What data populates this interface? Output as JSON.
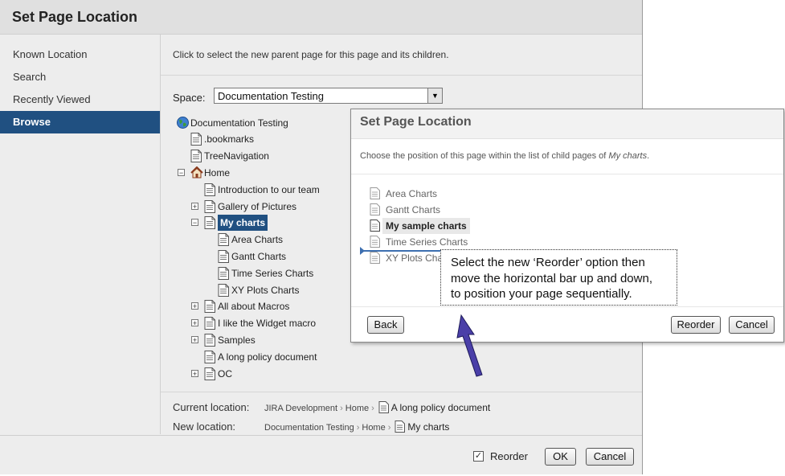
{
  "dialog": {
    "title": "Set Page Location",
    "nav": [
      {
        "label": "Known Location",
        "active": false
      },
      {
        "label": "Search",
        "active": false
      },
      {
        "label": "Recently Viewed",
        "active": false
      },
      {
        "label": "Browse",
        "active": true
      }
    ],
    "instruction": "Click to select the new parent page for this page and its children.",
    "space_label": "Space:",
    "space_value": "Documentation Testing",
    "tree": [
      {
        "label": "Documentation Testing",
        "icon": "globe-icon",
        "expander": ""
      },
      {
        "label": ".bookmarks",
        "icon": "page-icon",
        "expander": ""
      },
      {
        "label": "TreeNavigation",
        "icon": "page-icon",
        "expander": ""
      },
      {
        "label": "Home",
        "icon": "home-icon",
        "expander": "⊟"
      },
      {
        "label": "Introduction to our team",
        "icon": "page-icon",
        "expander": ""
      },
      {
        "label": "Gallery of Pictures",
        "icon": "page-icon",
        "expander": "⊞"
      },
      {
        "label": "My charts",
        "icon": "page-icon",
        "expander": "⊟",
        "selected": true
      },
      {
        "label": "Area Charts",
        "icon": "page-icon",
        "expander": ""
      },
      {
        "label": "Gantt Charts",
        "icon": "page-icon",
        "expander": ""
      },
      {
        "label": "Time Series Charts",
        "icon": "page-icon",
        "expander": ""
      },
      {
        "label": "XY Plots Charts",
        "icon": "page-icon",
        "expander": ""
      },
      {
        "label": "All about Macros",
        "icon": "page-icon",
        "expander": "⊞"
      },
      {
        "label": "I like the Widget macro",
        "icon": "page-icon",
        "expander": "⊞"
      },
      {
        "label": "Samples",
        "icon": "page-icon",
        "expander": "⊞"
      },
      {
        "label": "A long policy document",
        "icon": "page-icon",
        "expander": ""
      },
      {
        "label": "OC",
        "icon": "page-icon",
        "expander": "⊞"
      }
    ],
    "current_location": {
      "label": "Current location:",
      "space": "JIRA Development",
      "parent": "Home",
      "page": "A long policy document"
    },
    "new_location": {
      "label": "New location:",
      "space": "Documentation Testing",
      "parent": "Home",
      "page": "My charts"
    },
    "path_separator": "›",
    "reorder_label": "Reorder",
    "reorder_checked": true,
    "ok_label": "OK",
    "cancel_label": "Cancel"
  },
  "order_dialog": {
    "title": "Set Page Location",
    "instruction_prefix": "Choose the position of this page within the list of child pages of ",
    "instruction_parent": "My charts",
    "instruction_suffix": ".",
    "pages": [
      {
        "label": "Area Charts",
        "current": false
      },
      {
        "label": "Gantt Charts",
        "current": false
      },
      {
        "label": "My sample charts",
        "current": true
      },
      {
        "label": "Time Series Charts",
        "current": false
      },
      {
        "label": "XY Plots Charts",
        "current": false
      }
    ],
    "back_label": "Back",
    "reorder_label": "Reorder",
    "cancel_label": "Cancel"
  },
  "callout": {
    "lines": [
      "Select the new ‘Reorder’ option then",
      "move the horizontal bar up and down,",
      "to position your page sequentially."
    ]
  },
  "colors": {
    "accent": "#205081",
    "reorder_bar": "#3d6fb0",
    "arrow": "#4a3fa8"
  }
}
